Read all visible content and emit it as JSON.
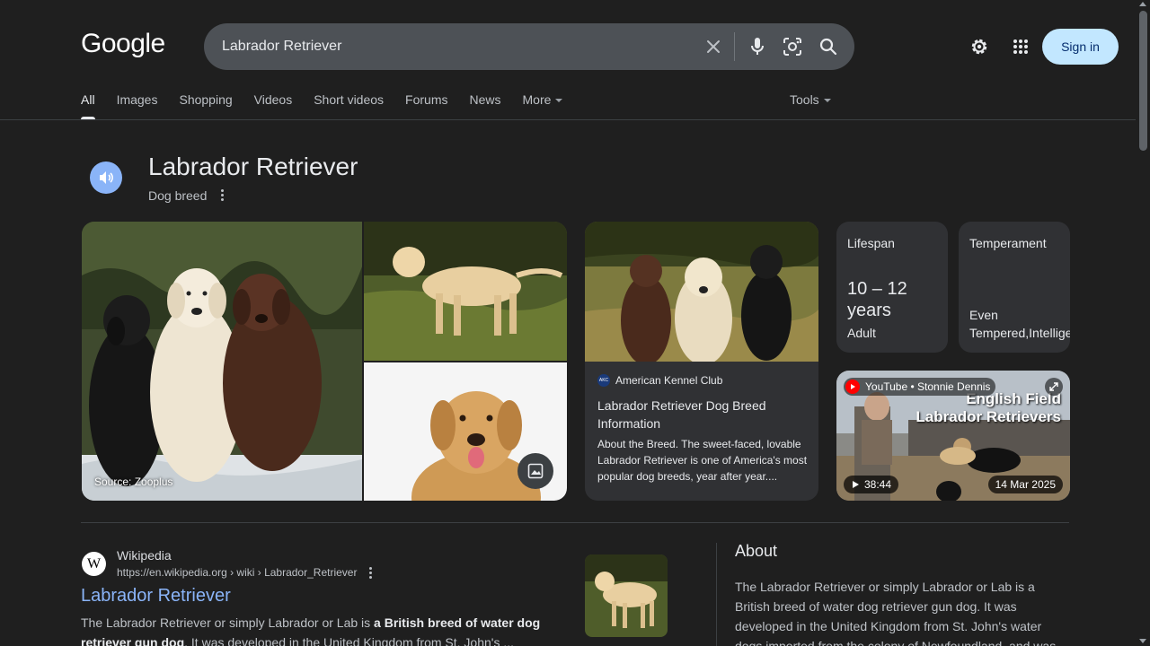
{
  "header": {
    "logo": "Google",
    "search": {
      "value": "Labrador Retriever"
    },
    "sign_in_label": "Sign in"
  },
  "tabs": [
    {
      "label": "All",
      "active": true
    },
    {
      "label": "Images"
    },
    {
      "label": "Shopping"
    },
    {
      "label": "Videos"
    },
    {
      "label": "Short videos"
    },
    {
      "label": "Forums"
    },
    {
      "label": "News"
    },
    {
      "label": "More"
    }
  ],
  "tools_label": "Tools",
  "knowledge": {
    "title": "Labrador Retriever",
    "subtitle": "Dog breed",
    "image_source": "Source: Zooplus"
  },
  "akc_card": {
    "source": "American Kennel Club",
    "logo_text": "AKC",
    "title": "Labrador Retriever Dog Breed Information",
    "description": "About the Breed. The sweet-faced, lovable Labrador Retriever is one of America's most popular dog breeds, year after year...."
  },
  "attributes": {
    "lifespan": {
      "label": "Lifespan",
      "value": "10 – 12 years",
      "sub": "Adult"
    },
    "temperament": {
      "label": "Temperament",
      "value_line1": "Even",
      "value_line2": "Tempered,Intelligent"
    }
  },
  "video": {
    "source": "YouTube • Stonnie Dennis",
    "overlay_title_1": "English Field",
    "overlay_title_2": "Labrador Retrievers",
    "duration": "38:44",
    "date": "14 Mar 2025"
  },
  "result": {
    "favicon_letter": "W",
    "site_name": "Wikipedia",
    "url": "https://en.wikipedia.org › wiki › Labrador_Retriever",
    "title": "Labrador Retriever",
    "snippet_pre": "The Labrador Retriever or simply Labrador or Lab is ",
    "snippet_bold": "a British breed of water dog retriever gun dog",
    "snippet_post": ". It was developed in the United Kingdom from St. John's ..."
  },
  "about": {
    "heading": "About",
    "text": "The Labrador Retriever or simply Labrador or Lab is a British breed of water dog retriever gun dog. It was developed in the United Kingdom from St. John's water dogs imported from the colony of Newfoundland, and was"
  },
  "colors": {
    "background": "#1f1f1f",
    "search_bg": "#4d5156",
    "link": "#8ab4f8",
    "signin_bg": "#c2e7ff",
    "card_bg": "#303134"
  },
  "icons": [
    "clear-icon",
    "mic-icon",
    "lens-icon",
    "search-icon",
    "gear-icon",
    "apps-icon",
    "speaker-icon",
    "kebab-icon",
    "image-search-icon",
    "youtube-icon",
    "expand-icon",
    "play-icon"
  ]
}
